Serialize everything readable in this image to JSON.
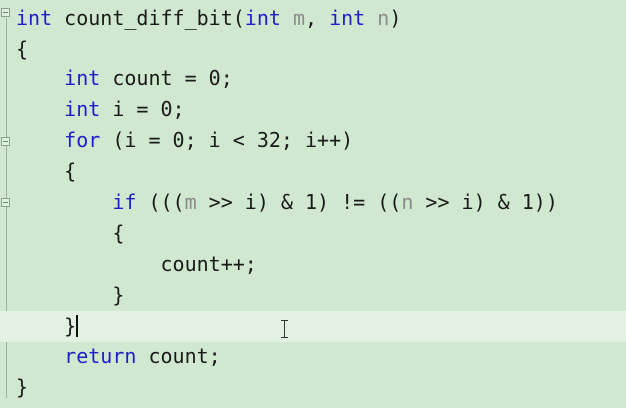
{
  "editor": {
    "background": "#cfe8cf",
    "keyword_color": "#1f1fc8",
    "parameter_color": "#8a8a8a",
    "lines": [
      {
        "tokens": [
          {
            "t": "kw",
            "v": "int"
          },
          {
            "t": "p",
            "v": " count_diff_bit("
          },
          {
            "t": "kw",
            "v": "int"
          },
          {
            "t": "p",
            "v": " "
          },
          {
            "t": "param",
            "v": "m"
          },
          {
            "t": "p",
            "v": ", "
          },
          {
            "t": "kw",
            "v": "int"
          },
          {
            "t": "p",
            "v": " "
          },
          {
            "t": "param",
            "v": "n"
          },
          {
            "t": "p",
            "v": ")"
          }
        ]
      },
      {
        "tokens": [
          {
            "t": "p",
            "v": "{"
          }
        ]
      },
      {
        "tokens": [
          {
            "t": "p",
            "v": "    "
          },
          {
            "t": "kw",
            "v": "int"
          },
          {
            "t": "p",
            "v": " count = 0;"
          }
        ]
      },
      {
        "tokens": [
          {
            "t": "p",
            "v": "    "
          },
          {
            "t": "kw",
            "v": "int"
          },
          {
            "t": "p",
            "v": " i = 0;"
          }
        ]
      },
      {
        "tokens": [
          {
            "t": "p",
            "v": "    "
          },
          {
            "t": "kw",
            "v": "for"
          },
          {
            "t": "p",
            "v": " (i = 0; i < 32; i++)"
          }
        ]
      },
      {
        "tokens": [
          {
            "t": "p",
            "v": "    {"
          }
        ]
      },
      {
        "tokens": [
          {
            "t": "p",
            "v": "        "
          },
          {
            "t": "kw",
            "v": "if"
          },
          {
            "t": "p",
            "v": " ((("
          },
          {
            "t": "param",
            "v": "m"
          },
          {
            "t": "p",
            "v": " >> i) & 1) != (("
          },
          {
            "t": "param",
            "v": "n"
          },
          {
            "t": "p",
            "v": " >> i) & 1))"
          }
        ]
      },
      {
        "tokens": [
          {
            "t": "p",
            "v": "        {"
          }
        ]
      },
      {
        "tokens": [
          {
            "t": "p",
            "v": "            count++;"
          }
        ]
      },
      {
        "tokens": [
          {
            "t": "p",
            "v": "        }"
          }
        ]
      },
      {
        "tokens": [
          {
            "t": "p",
            "v": "    }"
          }
        ]
      },
      {
        "tokens": [
          {
            "t": "p",
            "v": "    "
          },
          {
            "t": "kw",
            "v": "return"
          },
          {
            "t": "p",
            "v": " count;"
          }
        ]
      },
      {
        "tokens": [
          {
            "t": "p",
            "v": "}"
          }
        ]
      }
    ]
  }
}
